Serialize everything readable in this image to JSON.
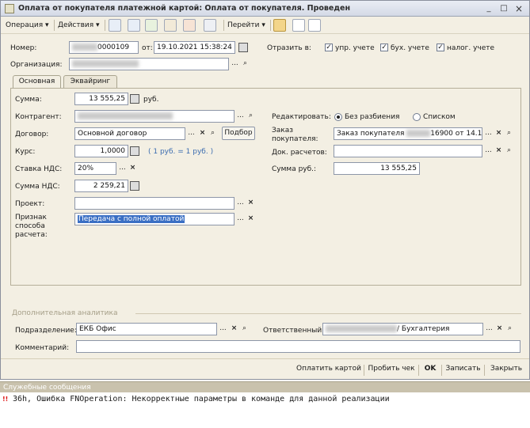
{
  "window": {
    "title": "Оплата от покупателя платежной картой: Оплата от покупателя. Проведен",
    "min": "_",
    "restore": "□",
    "close": "×"
  },
  "toolbar": {
    "operation": "Операция ▾",
    "actions": "Действия ▾",
    "goto": "Перейти ▾"
  },
  "header": {
    "number_label": "Номер:",
    "number_value": "0000109",
    "from_label": "от:",
    "date_value": "19.10.2021 15:38:24",
    "reflect_label": "Отразить в:",
    "reflect_mgmt": "упр. учете",
    "reflect_acc": "бух. учете",
    "reflect_tax": "налог. учете",
    "org_label": "Организация:"
  },
  "tabs": [
    "Основная",
    "Эквайринг"
  ],
  "main": {
    "sum_label": "Сумма:",
    "sum_value": "13 555,25",
    "sum_currency": "руб.",
    "counterparty_label": "Контрагент:",
    "contract_label": "Договор:",
    "contract_value": "Основной договор",
    "contract_pick": "Подбор",
    "rate_label": "Курс:",
    "rate_value": "1,0000",
    "rate_note": "( 1 руб. = 1 руб. )",
    "vat_rate_label": "Ставка НДС:",
    "vat_rate_value": "20%",
    "vat_sum_label": "Сумма НДС:",
    "vat_sum_value": "2 259,21",
    "project_label": "Проект:",
    "sign_label_1": "Признак",
    "sign_label_2": "способа",
    "sign_label_3": "расчета:",
    "sign_value": "Передача с полной оплатой",
    "edit_label": "Редактировать:",
    "edit_opt1": "Без разбиения",
    "edit_opt2": "Списком",
    "order_label_1": "Заказ",
    "order_label_2": "покупателя:",
    "order_value_a": "Заказ покупателя ",
    "order_value_b": "16900 от 14.1(",
    "docs_label": "Док. расчетов:",
    "sum_rub_label": "Сумма руб.:",
    "sum_rub_value": "13 555,25"
  },
  "extra": {
    "section_title": "Дополнительная аналитика",
    "dept_label": "Подразделение:",
    "dept_value": "ЕКБ Офис",
    "resp_label": "Ответственный:",
    "resp_value": "/ Бухгалтерия",
    "comment_label": "Комментарий:"
  },
  "buttons": {
    "pay_card": "Оплатить картой",
    "print_check": "Пробить чек",
    "ok": "OK",
    "save": "Записать",
    "close": "Закрыть"
  },
  "messages": {
    "title": "Служебные сообщения",
    "marker": "!!",
    "text": "36h, Ошибка FNOperation: Некорректные параметры в команде для данной реализации"
  },
  "glyphs": {
    "dots": "...",
    "search": "🔍",
    "clear": "×",
    "calc": "▦",
    "check": "✓"
  }
}
